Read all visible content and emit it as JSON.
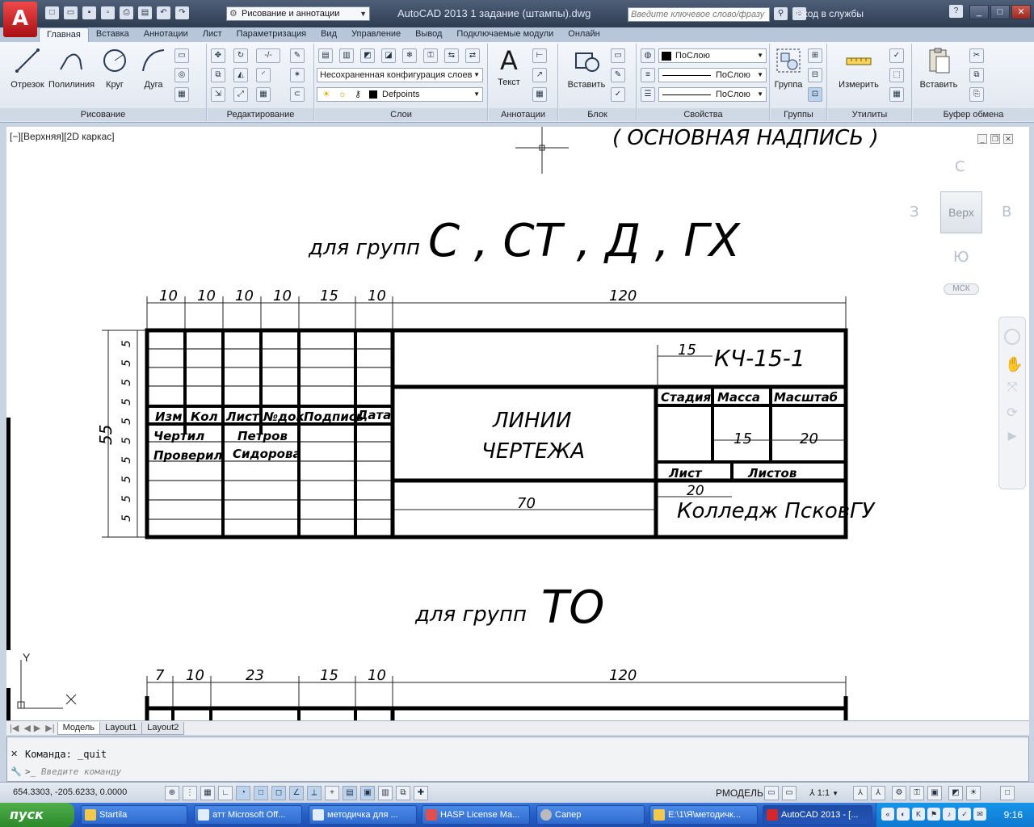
{
  "window": {
    "title": "AutoCAD 2013    1 задание (штампы).dwg",
    "workspace": "Рисование и аннотации",
    "search_placeholder": "Введите ключевое слово/фразу",
    "sign_in": "Вход в службы"
  },
  "ribbon_tabs": [
    "Главная",
    "Вставка",
    "Аннотации",
    "Лист",
    "Параметризация",
    "Вид",
    "Управление",
    "Вывод",
    "Подключаемые модули",
    "Онлайн"
  ],
  "ribbon": {
    "draw": {
      "title": "Рисование",
      "line": "Отрезок",
      "polyline": "Полилиния",
      "circle": "Круг",
      "arc": "Дуга"
    },
    "modify": {
      "title": "Редактирование"
    },
    "layers": {
      "title": "Слои",
      "state": "Несохраненная конфигурация слоев",
      "current_layer": "Defpoints"
    },
    "annotation": {
      "title": "Аннотации",
      "text": "Текст"
    },
    "block": {
      "title": "Блок",
      "insert": "Вставить"
    },
    "properties": {
      "title": "Свойства",
      "color": "ПоСлою",
      "linetype": "ПоСлою",
      "lineweight": "ПоСлою"
    },
    "groups": {
      "title": "Группы",
      "group": "Группа"
    },
    "utilities": {
      "title": "Утилиты",
      "measure": "Измерить"
    },
    "clipboard": {
      "title": "Буфер обмена",
      "paste": "Вставить"
    }
  },
  "viewport": {
    "label": "[−][Верхняя][2D каркас]",
    "viewcube": {
      "face": "Верх",
      "n": "С",
      "s": "Ю",
      "w": "З",
      "e": "В",
      "ucs": "МСК"
    }
  },
  "drawing": {
    "header_text": "( ОСНОВНАЯ НАДПИСЬ )",
    "title1": "для групп",
    "groups1": "С , СТ , Д , ГХ",
    "title2": "для групп",
    "groups2": "ТО",
    "top_dims": [
      "10",
      "10",
      "10",
      "10",
      "15",
      "10",
      "120"
    ],
    "left_dims": [
      "5",
      "5",
      "5",
      "5",
      "5",
      "5",
      "5",
      "5",
      "5",
      "5",
      "5"
    ],
    "total_height": "55",
    "col_heads": [
      "Изм",
      "Кол",
      "Лист",
      "№док",
      "Подпись",
      "Дата"
    ],
    "developed": "Чертил",
    "checked": "Проверил",
    "developer_name": "Петров",
    "checker_name": "Сидорова",
    "doc_code": "КЧ-15-1",
    "code_dim": "15",
    "drawing_name_1": "ЛИНИИ",
    "drawing_name_2": "ЧЕРТЕЖА",
    "stage": "Стадия",
    "mass": "Масса",
    "scale": "Масштаб",
    "dim_15": "15",
    "dim_20": "20",
    "sheet": "Лист",
    "sheets": "Листов",
    "dim_20b": "20",
    "dim_70": "70",
    "org": "Колледж ПсковГУ",
    "bottom_dims": [
      "7",
      "10",
      "23",
      "15",
      "10",
      "120"
    ]
  },
  "layout_tabs": [
    "Модель",
    "Layout1",
    "Layout2"
  ],
  "command": {
    "last": "Команда:  _quit",
    "placeholder": "Введите команду"
  },
  "status": {
    "coords": "654.3303, -205.6233, 0.0000",
    "model": "РМОДЕЛЬ",
    "scale": "1:1"
  },
  "taskbar": {
    "start": "пуск",
    "items": [
      "Startila",
      "атт Microsoft Off...",
      "методичка для ...",
      "HASP License Ma...",
      "Сапер",
      "E:\\1\\Я\\методичк...",
      "AutoCAD 2013 - [..."
    ],
    "clock": "9:16"
  }
}
